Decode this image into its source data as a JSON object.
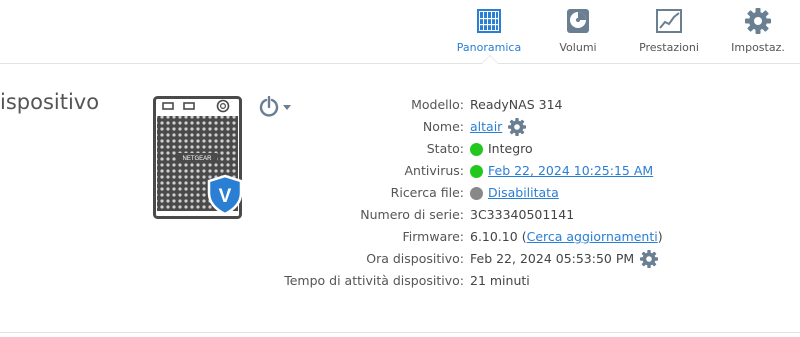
{
  "nav": {
    "items": [
      {
        "label": "Panoramica",
        "icon": "overview-grid-icon",
        "active": true
      },
      {
        "label": "Volumi",
        "icon": "volume-disk-icon",
        "active": false
      },
      {
        "label": "Prestazioni",
        "icon": "performance-chart-icon",
        "active": false
      },
      {
        "label": "Impostaz.",
        "icon": "settings-gear-icon",
        "active": false
      }
    ]
  },
  "section": {
    "title": "ispositivo"
  },
  "device": {
    "brand_text": "NETGEAR",
    "badge_letter": "V"
  },
  "info": {
    "model": {
      "label": "Modello:",
      "value": "ReadyNAS 314"
    },
    "name": {
      "label": "Nome:",
      "value": "altair"
    },
    "status": {
      "label": "Stato:",
      "value": "Integro",
      "dot_color": "#22c81e"
    },
    "antivirus": {
      "label": "Antivirus:",
      "value": "Feb 22, 2024 10:25:15 AM",
      "dot_color": "#22c81e"
    },
    "file_search": {
      "label": "Ricerca file:",
      "value": "Disabilitata",
      "dot_color": "#888888"
    },
    "serial": {
      "label": "Numero di serie:",
      "value": "3C33340501141"
    },
    "firmware": {
      "label": "Firmware:",
      "value": "6.10.10",
      "link": "Cerca aggiornamenti",
      "open": "(",
      "close": ")"
    },
    "device_time": {
      "label": "Ora dispositivo:",
      "value": "Feb 22, 2024 05:53:50 PM"
    },
    "uptime": {
      "label": "Tempo di attività dispositivo:",
      "value": "21 minuti"
    }
  },
  "colors": {
    "accent": "#2a7fd4",
    "icon_gray": "#6b7f92",
    "status_green": "#22c81e"
  }
}
